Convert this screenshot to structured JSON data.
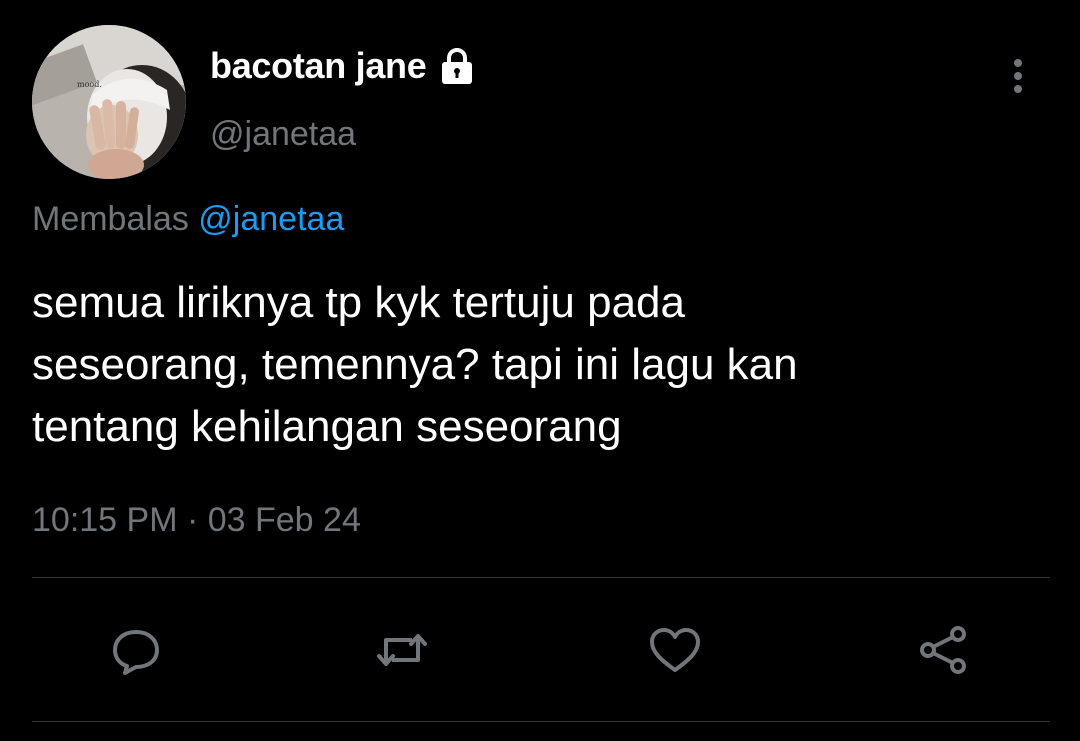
{
  "user": {
    "display_name": "bacotan jane",
    "handle": "@janetaa",
    "protected_icon": "lock-icon",
    "avatar_text": "mood."
  },
  "reply": {
    "prefix": "Membalas",
    "mention": "@janetaa"
  },
  "tweet": {
    "text": "semua liriknya tp kyk tertuju pada\nseseorang, temennya? tapi ini lagu kan\ntentang kehilangan seseorang",
    "timestamp": "10:15 PM · 03 Feb 24"
  },
  "actions": [
    {
      "name": "reply",
      "icon": "comment-icon"
    },
    {
      "name": "retweet",
      "icon": "retweet-icon"
    },
    {
      "name": "like",
      "icon": "heart-icon"
    },
    {
      "name": "share",
      "icon": "share-icon"
    }
  ],
  "colors": {
    "background": "#000000",
    "primary_text": "#ffffff",
    "secondary_text": "#71767b",
    "accent": "#1d9bf0",
    "divider": "#2f3336"
  }
}
